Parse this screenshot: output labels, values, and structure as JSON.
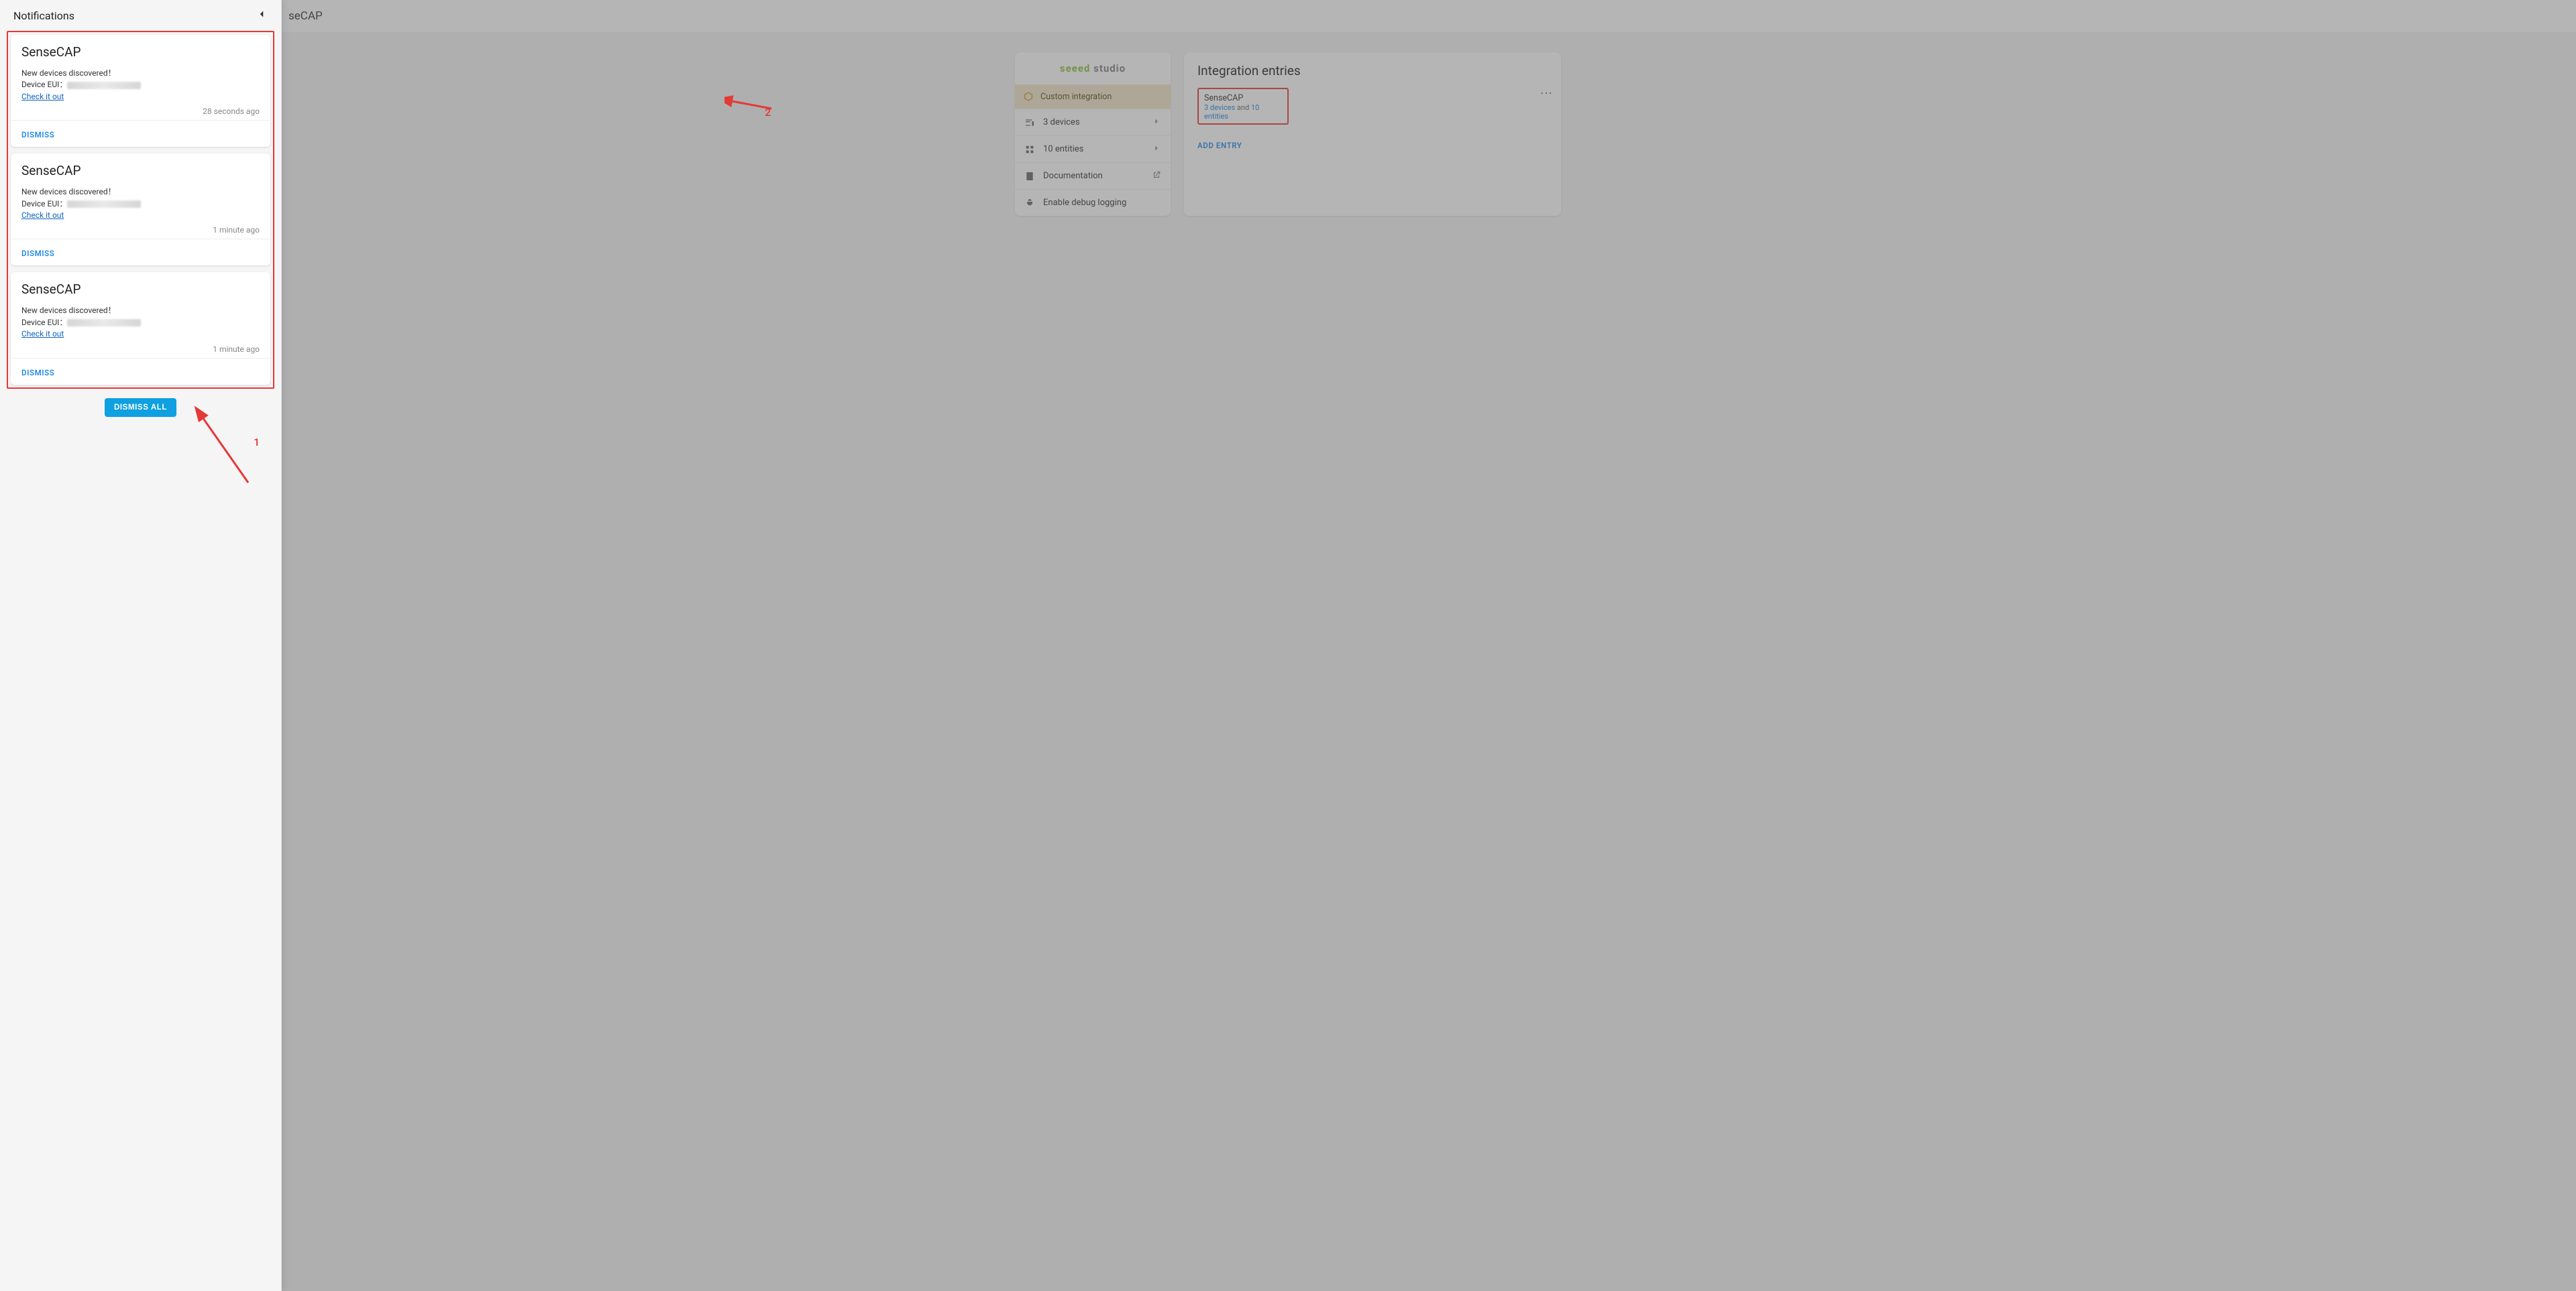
{
  "bg": {
    "header_crumb": "seCAP",
    "info_card": {
      "brand_green": "seeed",
      "brand_dark": " studio",
      "custom_integration": "Custom integration",
      "rows": [
        {
          "icon": "devices",
          "label": "3 devices",
          "tail": "chevron"
        },
        {
          "icon": "entities",
          "label": "10 entities",
          "tail": "chevron"
        },
        {
          "icon": "doc",
          "label": "Documentation",
          "tail": "open"
        },
        {
          "icon": "bug",
          "label": "Enable debug logging",
          "tail": ""
        }
      ]
    },
    "entries_card": {
      "title": "Integration entries",
      "entry_name": "SenseCAP",
      "devices_n": "3 devices",
      "and": " and ",
      "entities_n": "10 entities",
      "add_entry": "ADD ENTRY"
    }
  },
  "panel": {
    "title": "Notifications",
    "dismiss_all": "DISMISS ALL",
    "cards": [
      {
        "title": "SenseCAP",
        "line1": "New devices discovered！",
        "line2_label": "Device EUI：",
        "link": "Check it out",
        "time": "28 seconds ago",
        "dismiss": "DISMISS"
      },
      {
        "title": "SenseCAP",
        "line1": "New devices discovered！",
        "line2_label": "Device EUI：",
        "link": "Check it out",
        "time": "1 minute ago",
        "dismiss": "DISMISS"
      },
      {
        "title": "SenseCAP",
        "line1": "New devices discovered！",
        "line2_label": "Device EUI：",
        "link": "Check it out",
        "time": "1 minute ago",
        "dismiss": "DISMISS"
      }
    ]
  },
  "annotations": {
    "label1": "1",
    "label2": "2"
  }
}
